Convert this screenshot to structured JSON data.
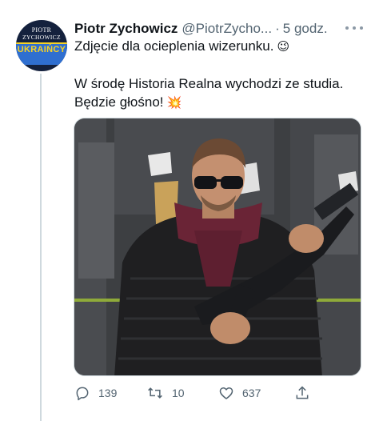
{
  "author": {
    "name": "Piotr Zychowicz",
    "handle": "@PiotrZycho...",
    "separator": "·",
    "time": "5 godz.",
    "avatar_line1": "PIOTR",
    "avatar_line2": "ZYCHOWICZ",
    "avatar_line3": "UKRAIŃCY"
  },
  "tweet": {
    "line1": "Zdjęcie dla ocieplenia wizerunku.",
    "line1_emoji": "😉",
    "line2": "W środę Historia Realna wychodzi ze studia.",
    "line3": "Będzie głośno!",
    "line3_emoji": "💥"
  },
  "actions": {
    "reply_count": "139",
    "retweet_count": "10",
    "like_count": "637"
  },
  "icons": {
    "reply": "reply-icon",
    "retweet": "retweet-icon",
    "like": "heart-icon",
    "share": "share-icon",
    "more": "more-icon"
  },
  "colors": {
    "text": "#0f1419",
    "muted": "#536471",
    "border": "#cfd9de"
  }
}
